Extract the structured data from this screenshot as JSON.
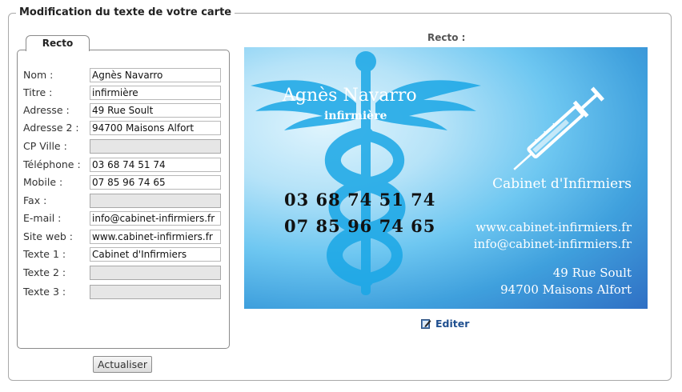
{
  "legend": "Modification du texte de votre carte",
  "tab": "Recto",
  "fields": [
    {
      "label": "Nom :",
      "value": "Agnès Navarro"
    },
    {
      "label": "Titre :",
      "value": "infirmière"
    },
    {
      "label": "Adresse :",
      "value": "49 Rue Soult"
    },
    {
      "label": "Adresse 2 :",
      "value": "94700 Maisons Alfort"
    },
    {
      "label": "CP Ville :",
      "value": ""
    },
    {
      "label": "Téléphone :",
      "value": "03 68 74 51 74"
    },
    {
      "label": "Mobile :",
      "value": "07 85 96 74 65"
    },
    {
      "label": "Fax :",
      "value": ""
    },
    {
      "label": "E-mail :",
      "value": "info@cabinet-infirmiers.fr"
    },
    {
      "label": "Site web :",
      "value": "www.cabinet-infirmiers.fr"
    },
    {
      "label": "Texte 1 :",
      "value": "Cabinet d'Infirmiers"
    },
    {
      "label": "Texte 2 :",
      "value": ""
    },
    {
      "label": "Texte 3 :",
      "value": ""
    }
  ],
  "button": "Actualiser",
  "preview": {
    "title": "Recto :",
    "name": "Agnès Navarro",
    "job": "infirmière",
    "phone": "03 68 74 51 74",
    "mobile": "07 85 96 74 65",
    "cabinet": "Cabinet d'Infirmiers",
    "website": "www.cabinet-infirmiers.fr",
    "email": "info@cabinet-infirmiers.fr",
    "address": "49 Rue Soult",
    "city": "94700 Maisons Alfort",
    "edit_label": "Editer",
    "edit_icon": "edit-icon"
  }
}
